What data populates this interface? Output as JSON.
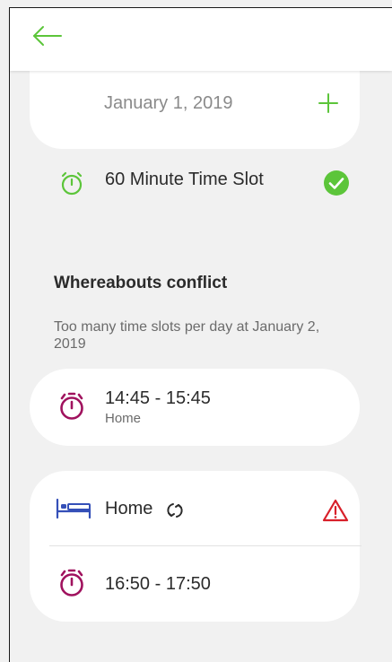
{
  "header": {
    "back_icon": "arrow-left-icon"
  },
  "date_card": {
    "date": "January 1, 2019",
    "add_icon": "plus-icon"
  },
  "timeslot": {
    "label": "60 Minute Time Slot",
    "icon": "stopwatch-icon",
    "status_icon": "check-circle-icon"
  },
  "conflict": {
    "title": "Whereabouts conflict",
    "description": "Too many time slots per day at January 2, 2019"
  },
  "slot_card": {
    "time": "14:45 - 15:45",
    "location": "Home",
    "icon": "stopwatch-icon"
  },
  "home_card": {
    "label": "Home",
    "icon": "bed-icon",
    "recurring_icon": "sync-icon",
    "warning_icon": "warning-triangle-icon",
    "time": "16:50 - 17:50",
    "time_icon": "stopwatch-icon"
  },
  "colors": {
    "accent_green": "#5cc53a",
    "stopwatch_magenta": "#a0125e",
    "bed_blue": "#3550b8",
    "warning_red": "#d8202a",
    "background": "#f1f1f1"
  }
}
